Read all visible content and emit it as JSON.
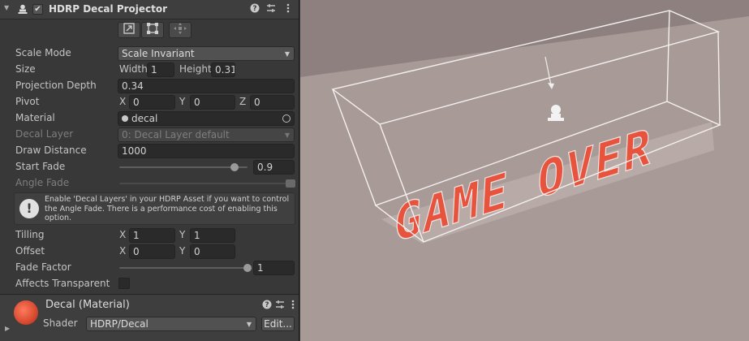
{
  "component": {
    "title": "HDRP Decal Projector",
    "enabled": true,
    "header_icons": [
      "help-icon",
      "presets-icon",
      "more-icon"
    ]
  },
  "edit_buttons": [
    "scale-mode-icon",
    "crop-mode-icon",
    "pivot-mode-icon"
  ],
  "fields": {
    "scale_mode": {
      "label": "Scale Mode",
      "value": "Scale Invariant"
    },
    "size": {
      "label": "Size",
      "width_label": "Width",
      "width": "1",
      "height_label": "Height",
      "height": "0.31"
    },
    "projection_depth": {
      "label": "Projection Depth",
      "value": "0.34"
    },
    "pivot": {
      "label": "Pivot",
      "x_label": "X",
      "x": "0",
      "y_label": "Y",
      "y": "0",
      "z_label": "Z",
      "z": "0"
    },
    "material": {
      "label": "Material",
      "value": "decal"
    },
    "decal_layer": {
      "label": "Decal Layer",
      "value": "0: Decal Layer default"
    },
    "draw_distance": {
      "label": "Draw Distance",
      "value": "1000"
    },
    "start_fade": {
      "label": "Start Fade",
      "value": "0.9",
      "fraction": 0.9
    },
    "angle_fade": {
      "label": "Angle Fade"
    },
    "help": "Enable 'Decal Layers' in your HDRP Asset if you want to control the Angle Fade. There is a performance cost of enabling this option.",
    "tilling": {
      "label": "Tilling",
      "x_label": "X",
      "x": "1",
      "y_label": "Y",
      "y": "1"
    },
    "offset": {
      "label": "Offset",
      "x_label": "X",
      "x": "0",
      "y_label": "Y",
      "y": "0"
    },
    "fade_factor": {
      "label": "Fade Factor",
      "value": "1",
      "fraction": 1.0
    },
    "affects_transparent": {
      "label": "Affects Transparent",
      "checked": false
    }
  },
  "material_section": {
    "title": "Decal (Material)",
    "shader_label": "Shader",
    "shader_value": "HDRP/Decal",
    "edit_label": "Edit..."
  },
  "scene": {
    "decal_text": "GAME OVER",
    "decal_color": "#e8533d"
  },
  "colors": {
    "panel_bg": "#383838",
    "field_bg": "#2a2a2a",
    "accent_decal": "#e8533d"
  }
}
